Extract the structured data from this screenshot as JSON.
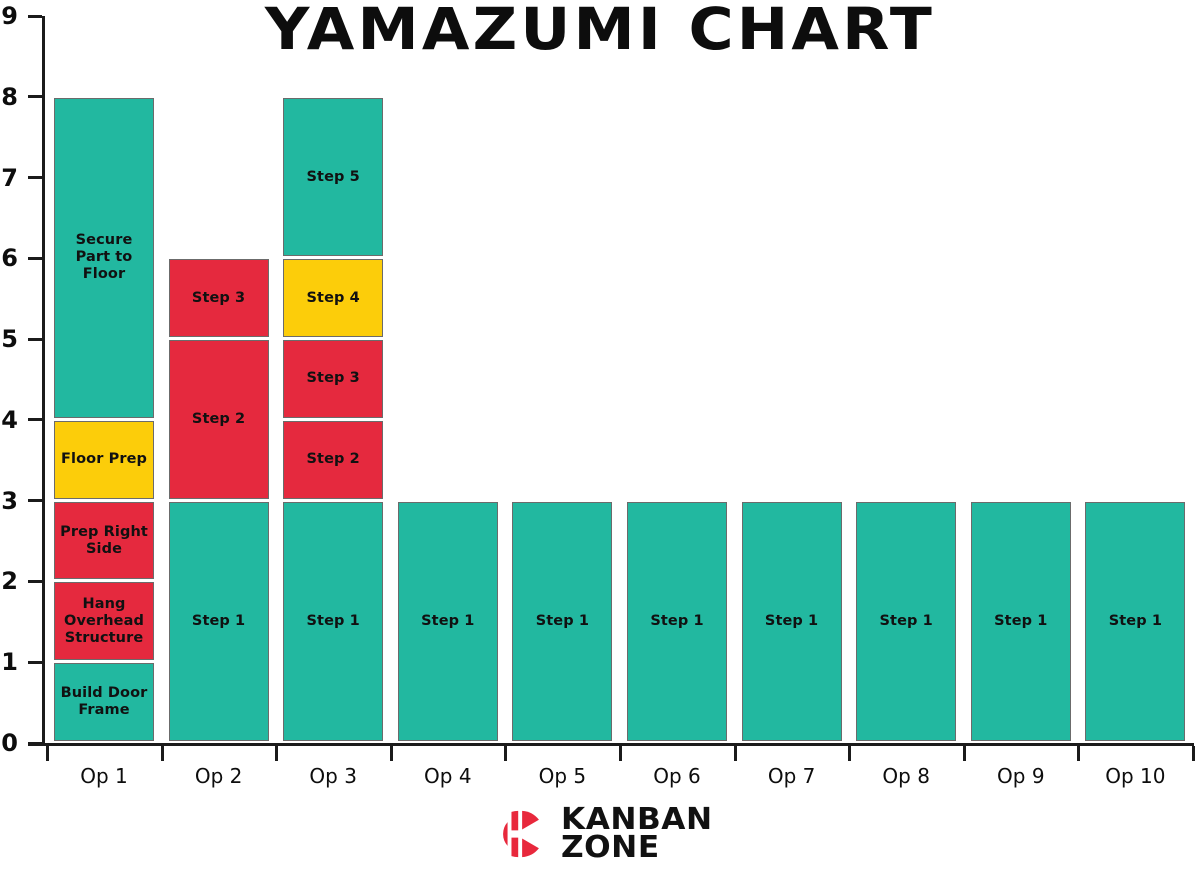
{
  "title": "YAMAZUMI CHART",
  "colors": {
    "teal": "#22B8A0",
    "red": "#E5293E",
    "yellow": "#FCCD0A",
    "axis": "#1B1B1B",
    "segment_border": "#6B6B6B",
    "background": "#FFFFFF",
    "brand_red": "#E8283C",
    "text": "#111111"
  },
  "footer": {
    "logo_name": "kanban-zone-logo",
    "line1": "KANBAN",
    "line2": "ZONE"
  },
  "chart_data": {
    "type": "bar",
    "subtype": "stacked",
    "title": "YAMAZUMI CHART",
    "xlabel": "",
    "ylabel": "",
    "ylim": [
      0,
      9
    ],
    "y_ticks": [
      0,
      1,
      2,
      3,
      4,
      5,
      6,
      7,
      8,
      9
    ],
    "grid": false,
    "legend": "none",
    "categories": [
      "Op 1",
      "Op 2",
      "Op 3",
      "Op 4",
      "Op 5",
      "Op 6",
      "Op 7",
      "Op 8",
      "Op 9",
      "Op 10"
    ],
    "totals": [
      8,
      6,
      8,
      3,
      3,
      3,
      3,
      3,
      3,
      3
    ],
    "columns": [
      {
        "category": "Op 1",
        "total": 8,
        "segments": [
          {
            "label": "Build Door Frame",
            "value": 1,
            "start": 0,
            "end": 1,
            "color": "#22B8A0"
          },
          {
            "label": "Hang Overhead Structure",
            "value": 1,
            "start": 1,
            "end": 2,
            "color": "#E5293E"
          },
          {
            "label": "Prep Right Side",
            "value": 1,
            "start": 2,
            "end": 3,
            "color": "#E5293E"
          },
          {
            "label": "Floor Prep",
            "value": 1,
            "start": 3,
            "end": 4,
            "color": "#FCCD0A"
          },
          {
            "label": "Secure Part to Floor",
            "value": 4,
            "start": 4,
            "end": 8,
            "color": "#22B8A0"
          }
        ]
      },
      {
        "category": "Op 2",
        "total": 6,
        "segments": [
          {
            "label": "Step 1",
            "value": 3,
            "start": 0,
            "end": 3,
            "color": "#22B8A0"
          },
          {
            "label": "Step 2",
            "value": 2,
            "start": 3,
            "end": 5,
            "color": "#E5293E"
          },
          {
            "label": "Step 3",
            "value": 1,
            "start": 5,
            "end": 6,
            "color": "#E5293E"
          }
        ]
      },
      {
        "category": "Op 3",
        "total": 8,
        "segments": [
          {
            "label": "Step 1",
            "value": 3,
            "start": 0,
            "end": 3,
            "color": "#22B8A0"
          },
          {
            "label": "Step 2",
            "value": 1,
            "start": 3,
            "end": 4,
            "color": "#E5293E"
          },
          {
            "label": "Step 3",
            "value": 1,
            "start": 4,
            "end": 5,
            "color": "#E5293E"
          },
          {
            "label": "Step 4",
            "value": 1,
            "start": 5,
            "end": 6,
            "color": "#FCCD0A"
          },
          {
            "label": "Step 5",
            "value": 2,
            "start": 6,
            "end": 8,
            "color": "#22B8A0"
          }
        ]
      },
      {
        "category": "Op 4",
        "total": 3,
        "segments": [
          {
            "label": "Step 1",
            "value": 3,
            "start": 0,
            "end": 3,
            "color": "#22B8A0"
          }
        ]
      },
      {
        "category": "Op 5",
        "total": 3,
        "segments": [
          {
            "label": "Step 1",
            "value": 3,
            "start": 0,
            "end": 3,
            "color": "#22B8A0"
          }
        ]
      },
      {
        "category": "Op 6",
        "total": 3,
        "segments": [
          {
            "label": "Step 1",
            "value": 3,
            "start": 0,
            "end": 3,
            "color": "#22B8A0"
          }
        ]
      },
      {
        "category": "Op 7",
        "total": 3,
        "segments": [
          {
            "label": "Step 1",
            "value": 3,
            "start": 0,
            "end": 3,
            "color": "#22B8A0"
          }
        ]
      },
      {
        "category": "Op 8",
        "total": 3,
        "segments": [
          {
            "label": "Step 1",
            "value": 3,
            "start": 0,
            "end": 3,
            "color": "#22B8A0"
          }
        ]
      },
      {
        "category": "Op 9",
        "total": 3,
        "segments": [
          {
            "label": "Step 1",
            "value": 3,
            "start": 0,
            "end": 3,
            "color": "#22B8A0"
          }
        ]
      },
      {
        "category": "Op 10",
        "total": 3,
        "segments": [
          {
            "label": "Step 1",
            "value": 3,
            "start": 0,
            "end": 3,
            "color": "#22B8A0"
          }
        ]
      }
    ]
  }
}
